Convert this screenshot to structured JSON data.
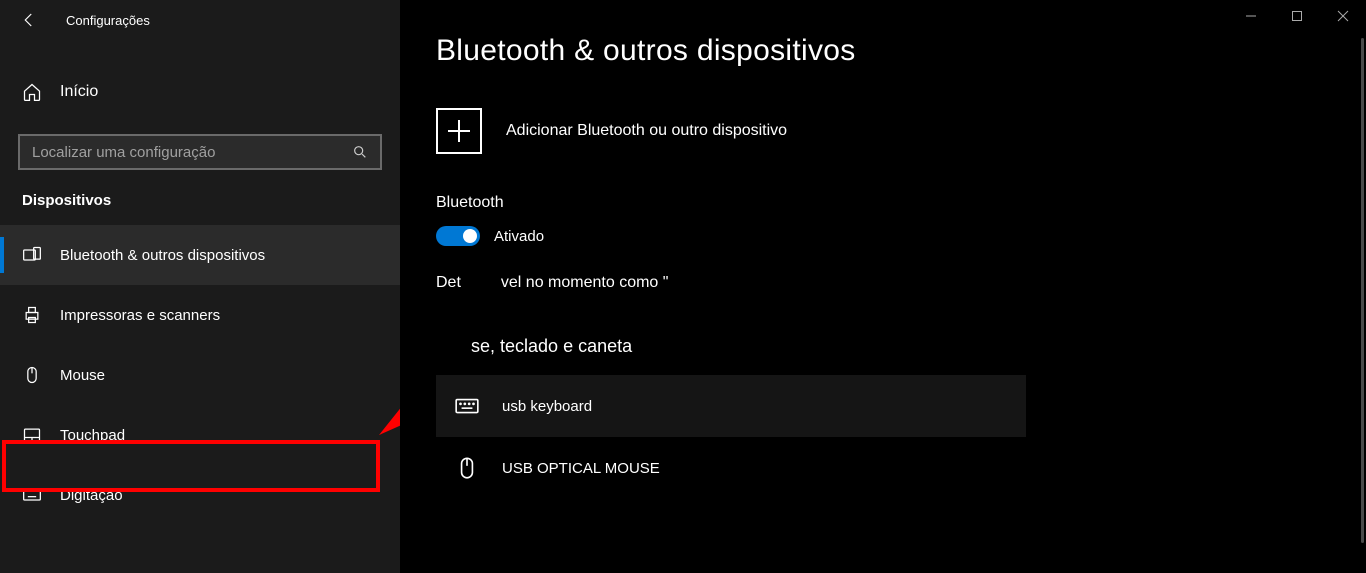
{
  "titlebar": {
    "title": "Configurações"
  },
  "home": {
    "label": "Início"
  },
  "search": {
    "placeholder": "Localizar uma configuração"
  },
  "section": {
    "title": "Dispositivos"
  },
  "nav": {
    "bluetooth": "Bluetooth & outros dispositivos",
    "printers": "Impressoras e scanners",
    "mouse": "Mouse",
    "touchpad": "Touchpad",
    "typing": "Digitação"
  },
  "main": {
    "title": "Bluetooth & outros dispositivos",
    "add_label": "Adicionar Bluetooth ou outro dispositivo",
    "bt_label": "Bluetooth",
    "toggle_label": "Ativado",
    "detect_prefix": "Det",
    "detect_suffix": "vel no momento como \"",
    "section1": "se, teclado e caneta",
    "device1": "usb keyboard",
    "device2": "USB OPTICAL MOUSE"
  },
  "annotation": {
    "highlight_target": "touchpad"
  }
}
